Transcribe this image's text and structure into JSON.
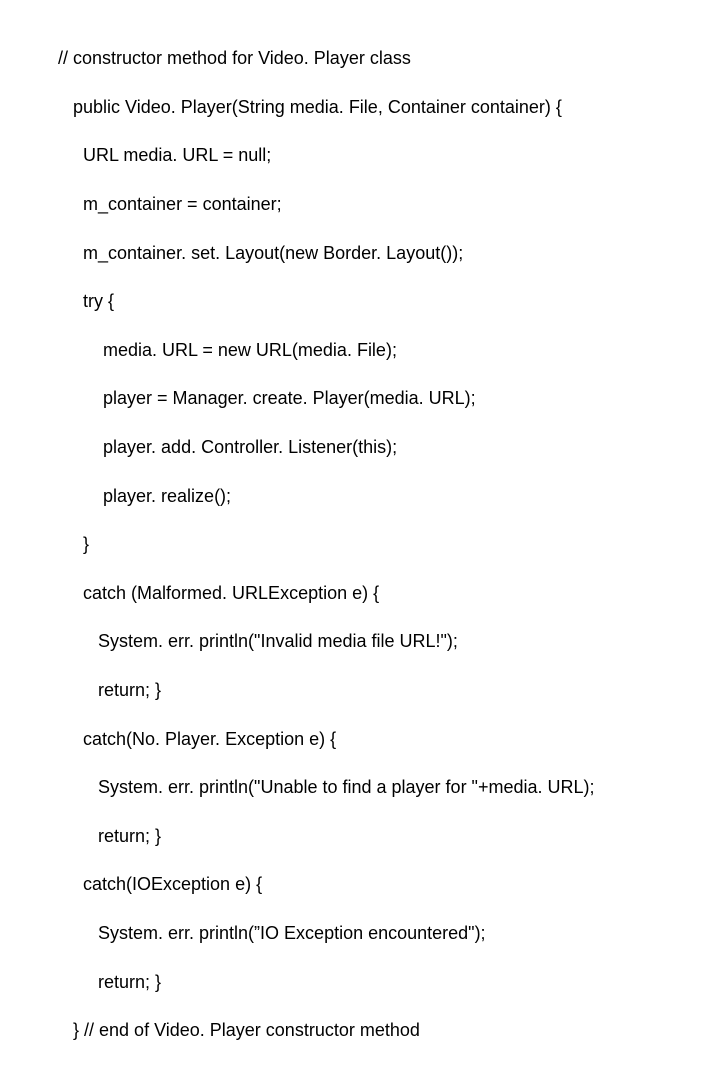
{
  "code": {
    "lines": [
      "// constructor method for Video. Player class",
      "   public Video. Player(String media. File, Container container) {",
      "     URL media. URL = null;",
      "     m_container = container;",
      "     m_container. set. Layout(new Border. Layout());",
      "     try {",
      "         media. URL = new URL(media. File);",
      "         player = Manager. create. Player(media. URL);",
      "         player. add. Controller. Listener(this);",
      "         player. realize();",
      "     }",
      "     catch (Malformed. URLException e) {",
      "        System. err. println(\"Invalid media file URL!\");",
      "        return; }",
      "     catch(No. Player. Exception e) {",
      "        System. err. println(\"Unable to find a player for \"+media. URL);",
      "        return; }",
      "     catch(IOException e) {",
      "        System. err. println(”IO Exception encountered\");",
      "        return; }",
      "   } // end of Video. Player constructor method"
    ]
  }
}
